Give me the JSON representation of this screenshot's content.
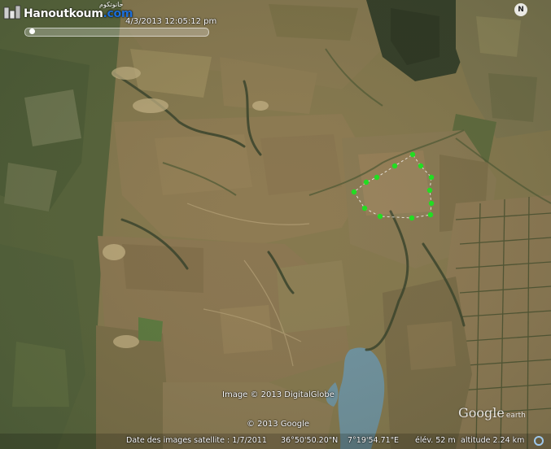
{
  "watermark": {
    "brand": "Hanoutkoum",
    "domain": ".com",
    "arabic": "حانوتكوم"
  },
  "timeline": {
    "datetime": "4/3/2013  12:05:12 pm"
  },
  "compass": {
    "label": "N"
  },
  "map": {
    "polygon_color": "#22dd22",
    "water_color": "#6f95a6"
  },
  "credits": {
    "imagery": "Image © 2013 DigitalGlobe",
    "google": "© 2013 Google"
  },
  "logo": {
    "name": "Google",
    "suffix": "earth"
  },
  "status": {
    "imagery_date": "Date des images satellite : 1/7/2011",
    "latitude": "36°50'50.20\"N",
    "longitude": "7°19'54.71\"E",
    "elevation": "élév.  52 m",
    "altitude": "altitude  2.24 km"
  }
}
